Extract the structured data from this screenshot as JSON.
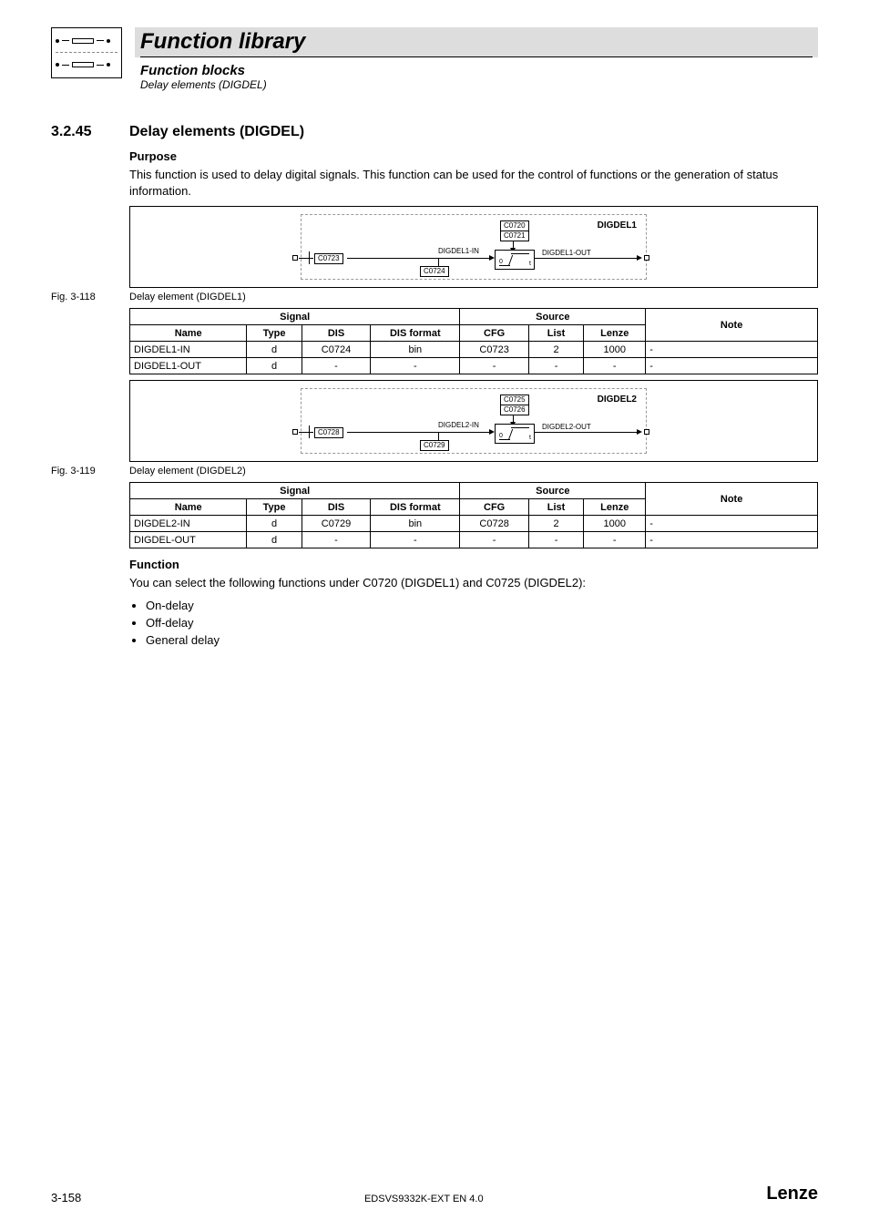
{
  "header": {
    "title": "Function library",
    "sub1": "Function blocks",
    "sub2": "Delay elements (DIGDEL)"
  },
  "section": {
    "num": "3.2.45",
    "title": "Delay elements (DIGDEL)"
  },
  "purpose": {
    "heading": "Purpose",
    "text": "This function is used to delay digital signals. This function can be used for the control of functions or the generation of status information."
  },
  "diagram1": {
    "name": "DIGDEL1",
    "topbox1": "C0720",
    "topbox2": "C0721",
    "inPort": "C0723",
    "bottomPort": "C0724",
    "inLabel": "DIGDEL1-IN",
    "outLabel": "DIGDEL1-OUT"
  },
  "fig1": {
    "num": "Fig. 3-118",
    "caption": "Delay element (DIGDEL1)"
  },
  "table1": {
    "signalHdr": "Signal",
    "sourceHdr": "Source",
    "noteHdr": "Note",
    "cols": {
      "name": "Name",
      "type": "Type",
      "dis": "DIS",
      "disf": "DIS format",
      "cfg": "CFG",
      "list": "List",
      "lenze": "Lenze"
    },
    "rows": [
      {
        "name": "DIGDEL1-IN",
        "type": "d",
        "dis": "C0724",
        "disf": "bin",
        "cfg": "C0723",
        "list": "2",
        "lenze": "1000",
        "note": "-"
      },
      {
        "name": "DIGDEL1-OUT",
        "type": "d",
        "dis": "-",
        "disf": "-",
        "cfg": "-",
        "list": "-",
        "lenze": "-",
        "note": "-"
      }
    ]
  },
  "diagram2": {
    "name": "DIGDEL2",
    "topbox1": "C0725",
    "topbox2": "C0726",
    "inPort": "C0728",
    "bottomPort": "C0729",
    "inLabel": "DIGDEL2-IN",
    "outLabel": "DIGDEL2-OUT"
  },
  "fig2": {
    "num": "Fig. 3-119",
    "caption": "Delay element (DIGDEL2)"
  },
  "table2": {
    "signalHdr": "Signal",
    "sourceHdr": "Source",
    "noteHdr": "Note",
    "cols": {
      "name": "Name",
      "type": "Type",
      "dis": "DIS",
      "disf": "DIS format",
      "cfg": "CFG",
      "list": "List",
      "lenze": "Lenze"
    },
    "rows": [
      {
        "name": "DIGDEL2-IN",
        "type": "d",
        "dis": "C0729",
        "disf": "bin",
        "cfg": "C0728",
        "list": "2",
        "lenze": "1000",
        "note": "-"
      },
      {
        "name": "DIGDEL-OUT",
        "type": "d",
        "dis": "-",
        "disf": "-",
        "cfg": "-",
        "list": "-",
        "lenze": "-",
        "note": "-"
      }
    ]
  },
  "function": {
    "heading": "Function",
    "text": "You can select the following functions under C0720 (DIGDEL1) and C0725 (DIGDEL2):",
    "items": [
      "On-delay",
      "Off-delay",
      "General delay"
    ]
  },
  "footer": {
    "page": "3-158",
    "docid": "EDSVS9332K-EXT EN 4.0",
    "brand": "Lenze"
  }
}
